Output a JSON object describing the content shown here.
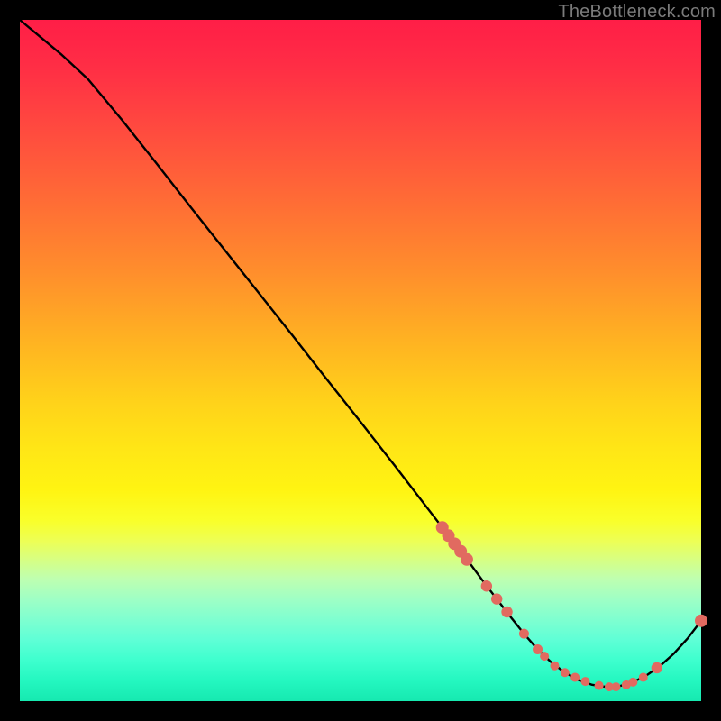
{
  "watermark": "TheBottleneck.com",
  "colors": {
    "background": "#000000",
    "curve": "#000000",
    "marker": "#e16a60",
    "gradient_top": "#ff1e47",
    "gradient_bottom": "#16e9b0"
  },
  "chart_data": {
    "type": "line",
    "title": "",
    "xlabel": "",
    "ylabel": "",
    "xlim": [
      0,
      100
    ],
    "ylim": [
      0,
      100
    ],
    "x": [
      0,
      3,
      6,
      10,
      15,
      20,
      25,
      30,
      35,
      40,
      45,
      50,
      55,
      60,
      62,
      64,
      66,
      68,
      70,
      72,
      74,
      76,
      78,
      80,
      82,
      84,
      86,
      88,
      90,
      92,
      94,
      96,
      98,
      100
    ],
    "values": [
      100,
      97.5,
      95.0,
      91.3,
      85.3,
      79.0,
      72.6,
      66.3,
      60.0,
      53.7,
      47.3,
      41.0,
      34.6,
      28.1,
      25.5,
      22.9,
      20.3,
      17.6,
      15.0,
      12.4,
      9.9,
      7.6,
      5.7,
      4.2,
      3.1,
      2.4,
      2.1,
      2.2,
      2.8,
      3.8,
      5.2,
      7.0,
      9.2,
      11.8
    ],
    "markers_x": [
      62.0,
      62.9,
      63.8,
      64.7,
      65.6,
      68.5,
      70.0,
      71.5,
      74.0,
      76.0,
      77.0,
      78.5,
      80.0,
      81.5,
      83.0,
      85.0,
      86.5,
      87.5,
      89.0,
      90.0,
      91.5,
      93.5,
      100.0
    ],
    "markers_values": [
      25.5,
      24.3,
      23.1,
      22.0,
      20.8,
      16.9,
      15.0,
      13.1,
      9.9,
      7.6,
      6.6,
      5.2,
      4.2,
      3.5,
      2.9,
      2.3,
      2.1,
      2.1,
      2.4,
      2.8,
      3.5,
      4.9,
      11.8
    ],
    "marker_radius_values": [
      7.0,
      7.0,
      7.0,
      7.0,
      7.0,
      6.2,
      6.2,
      6.2,
      5.5,
      5.5,
      5.0,
      5.0,
      5.0,
      5.0,
      5.0,
      5.0,
      5.0,
      5.0,
      5.0,
      5.0,
      5.0,
      6.2,
      7.0
    ]
  }
}
